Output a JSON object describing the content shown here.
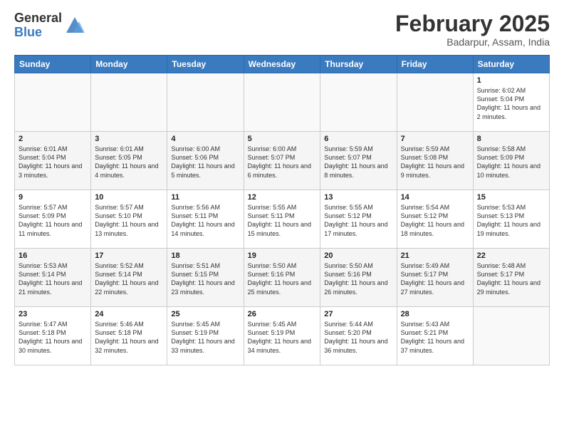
{
  "header": {
    "logo_general": "General",
    "logo_blue": "Blue",
    "month_title": "February 2025",
    "location": "Badarpur, Assam, India"
  },
  "weekdays": [
    "Sunday",
    "Monday",
    "Tuesday",
    "Wednesday",
    "Thursday",
    "Friday",
    "Saturday"
  ],
  "weeks": [
    [
      {
        "day": "",
        "info": ""
      },
      {
        "day": "",
        "info": ""
      },
      {
        "day": "",
        "info": ""
      },
      {
        "day": "",
        "info": ""
      },
      {
        "day": "",
        "info": ""
      },
      {
        "day": "",
        "info": ""
      },
      {
        "day": "1",
        "info": "Sunrise: 6:02 AM\nSunset: 5:04 PM\nDaylight: 11 hours\nand 2 minutes."
      }
    ],
    [
      {
        "day": "2",
        "info": "Sunrise: 6:01 AM\nSunset: 5:04 PM\nDaylight: 11 hours\nand 3 minutes."
      },
      {
        "day": "3",
        "info": "Sunrise: 6:01 AM\nSunset: 5:05 PM\nDaylight: 11 hours\nand 4 minutes."
      },
      {
        "day": "4",
        "info": "Sunrise: 6:00 AM\nSunset: 5:06 PM\nDaylight: 11 hours\nand 5 minutes."
      },
      {
        "day": "5",
        "info": "Sunrise: 6:00 AM\nSunset: 5:07 PM\nDaylight: 11 hours\nand 6 minutes."
      },
      {
        "day": "6",
        "info": "Sunrise: 5:59 AM\nSunset: 5:07 PM\nDaylight: 11 hours\nand 8 minutes."
      },
      {
        "day": "7",
        "info": "Sunrise: 5:59 AM\nSunset: 5:08 PM\nDaylight: 11 hours\nand 9 minutes."
      },
      {
        "day": "8",
        "info": "Sunrise: 5:58 AM\nSunset: 5:09 PM\nDaylight: 11 hours\nand 10 minutes."
      }
    ],
    [
      {
        "day": "9",
        "info": "Sunrise: 5:57 AM\nSunset: 5:09 PM\nDaylight: 11 hours\nand 11 minutes."
      },
      {
        "day": "10",
        "info": "Sunrise: 5:57 AM\nSunset: 5:10 PM\nDaylight: 11 hours\nand 13 minutes."
      },
      {
        "day": "11",
        "info": "Sunrise: 5:56 AM\nSunset: 5:11 PM\nDaylight: 11 hours\nand 14 minutes."
      },
      {
        "day": "12",
        "info": "Sunrise: 5:55 AM\nSunset: 5:11 PM\nDaylight: 11 hours\nand 15 minutes."
      },
      {
        "day": "13",
        "info": "Sunrise: 5:55 AM\nSunset: 5:12 PM\nDaylight: 11 hours\nand 17 minutes."
      },
      {
        "day": "14",
        "info": "Sunrise: 5:54 AM\nSunset: 5:12 PM\nDaylight: 11 hours\nand 18 minutes."
      },
      {
        "day": "15",
        "info": "Sunrise: 5:53 AM\nSunset: 5:13 PM\nDaylight: 11 hours\nand 19 minutes."
      }
    ],
    [
      {
        "day": "16",
        "info": "Sunrise: 5:53 AM\nSunset: 5:14 PM\nDaylight: 11 hours\nand 21 minutes."
      },
      {
        "day": "17",
        "info": "Sunrise: 5:52 AM\nSunset: 5:14 PM\nDaylight: 11 hours\nand 22 minutes."
      },
      {
        "day": "18",
        "info": "Sunrise: 5:51 AM\nSunset: 5:15 PM\nDaylight: 11 hours\nand 23 minutes."
      },
      {
        "day": "19",
        "info": "Sunrise: 5:50 AM\nSunset: 5:16 PM\nDaylight: 11 hours\nand 25 minutes."
      },
      {
        "day": "20",
        "info": "Sunrise: 5:50 AM\nSunset: 5:16 PM\nDaylight: 11 hours\nand 26 minutes."
      },
      {
        "day": "21",
        "info": "Sunrise: 5:49 AM\nSunset: 5:17 PM\nDaylight: 11 hours\nand 27 minutes."
      },
      {
        "day": "22",
        "info": "Sunrise: 5:48 AM\nSunset: 5:17 PM\nDaylight: 11 hours\nand 29 minutes."
      }
    ],
    [
      {
        "day": "23",
        "info": "Sunrise: 5:47 AM\nSunset: 5:18 PM\nDaylight: 11 hours\nand 30 minutes."
      },
      {
        "day": "24",
        "info": "Sunrise: 5:46 AM\nSunset: 5:18 PM\nDaylight: 11 hours\nand 32 minutes."
      },
      {
        "day": "25",
        "info": "Sunrise: 5:45 AM\nSunset: 5:19 PM\nDaylight: 11 hours\nand 33 minutes."
      },
      {
        "day": "26",
        "info": "Sunrise: 5:45 AM\nSunset: 5:19 PM\nDaylight: 11 hours\nand 34 minutes."
      },
      {
        "day": "27",
        "info": "Sunrise: 5:44 AM\nSunset: 5:20 PM\nDaylight: 11 hours\nand 36 minutes."
      },
      {
        "day": "28",
        "info": "Sunrise: 5:43 AM\nSunset: 5:21 PM\nDaylight: 11 hours\nand 37 minutes."
      },
      {
        "day": "",
        "info": ""
      }
    ]
  ]
}
